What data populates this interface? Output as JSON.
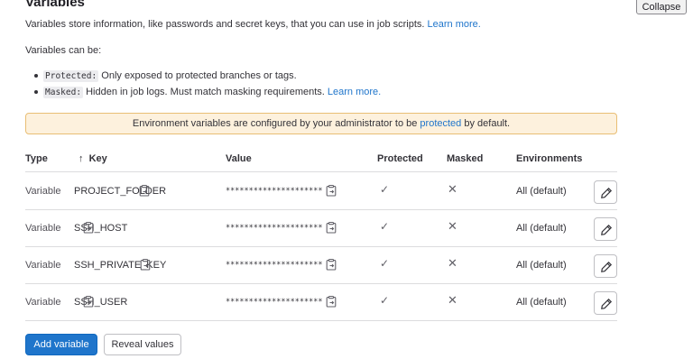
{
  "section": {
    "title": "Variables",
    "collapse_label": "Collapse",
    "description": "Variables store information, like passwords and secret keys, that you can use in job scripts.",
    "learn_more": "Learn more.",
    "can_be": "Variables can be:",
    "bullets": [
      {
        "code": "Protected:",
        "text": "Only exposed to protected branches or tags.",
        "link": ""
      },
      {
        "code": "Masked:",
        "text": "Hidden in job logs. Must match masking requirements.",
        "link": "Learn more."
      }
    ]
  },
  "alert": {
    "before": "Environment variables are configured by your administrator to be",
    "link": "protected",
    "after": "by default."
  },
  "table": {
    "headers": {
      "type": "Type",
      "sort_arrow": "↑",
      "key": "Key",
      "value": "Value",
      "protected": "Protected",
      "masked": "Masked",
      "environments": "Environments"
    },
    "rows": [
      {
        "type": "Variable",
        "key": "PROJECT_FOLDER",
        "value": "*********************",
        "protected": "✓",
        "masked": "✕",
        "environment": "All (default)"
      },
      {
        "type": "Variable",
        "key": "SSH_HOST",
        "value": "*********************",
        "protected": "✓",
        "masked": "✕",
        "environment": "All (default)"
      },
      {
        "type": "Variable",
        "key": "SSH_PRIVATE_KEY",
        "value": "*********************",
        "protected": "✓",
        "masked": "✕",
        "environment": "All (default)"
      },
      {
        "type": "Variable",
        "key": "SSH_USER",
        "value": "*********************",
        "protected": "✓",
        "masked": "✕",
        "environment": "All (default)"
      }
    ]
  },
  "actions": {
    "add_variable": "Add variable",
    "reveal_values": "Reveal values"
  },
  "icons": {
    "copy": "copy-to-clipboard-icon",
    "edit": "pencil-icon"
  },
  "colors": {
    "primary": "#1f75cb",
    "link": "#1f75cb",
    "alert_bg": "#fdf1dd",
    "alert_border": "#e9be74"
  }
}
